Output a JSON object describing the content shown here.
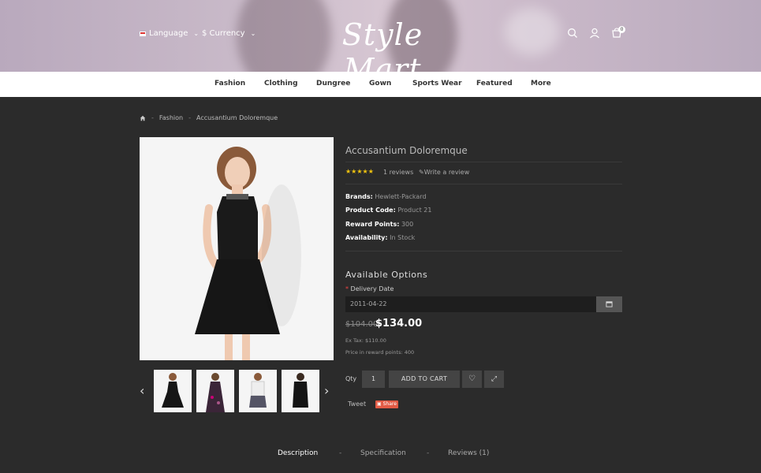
{
  "header": {
    "language_label": "Language",
    "currency_label": "$ Currency",
    "logo_text": "Style Mart",
    "cart_count": "0"
  },
  "menu": {
    "items": [
      "Fashion",
      "Clothing",
      "Dungree",
      "Gown",
      "Sports Wear",
      "Featured",
      "More"
    ]
  },
  "breadcrumb": {
    "items": [
      "Fashion",
      "Accusantium Doloremque"
    ]
  },
  "product": {
    "title": "Accusantium Doloremque",
    "rating": 5,
    "reviews_text": "1 reviews",
    "write_review": "Write a review",
    "brand_label": "Brands:",
    "brand_value": "Hewlett-Packard",
    "code_label": "Product Code:",
    "code_value": "Product 21",
    "reward_label": "Reward Points:",
    "reward_value": "300",
    "availability_label": "Availability:",
    "availability_value": "In Stock",
    "options_title": "Available Options",
    "delivery_label": "Delivery Date",
    "delivery_value": "2011-04-22",
    "old_price": "$104.00",
    "new_price": "$134.00",
    "ex_tax": "Ex Tax: $110.00",
    "reward_price": "Price in reward points: 400",
    "qty_label": "Qty",
    "qty_value": "1",
    "add_to_cart": "ADD TO CART",
    "tweet": "Tweet",
    "share": "Share"
  },
  "tabs": [
    "Description",
    "Specification",
    "Reviews (1)"
  ],
  "icons": [
    "home-icon",
    "search-icon",
    "user-icon",
    "cart-icon",
    "calendar-icon",
    "heart-icon",
    "compare-icon",
    "pencil-icon",
    "chevron-left-icon",
    "chevron-right-icon"
  ],
  "colors": {
    "accent": "#e25b45",
    "star": "#f1c40f",
    "background": "#2b2b2b"
  }
}
